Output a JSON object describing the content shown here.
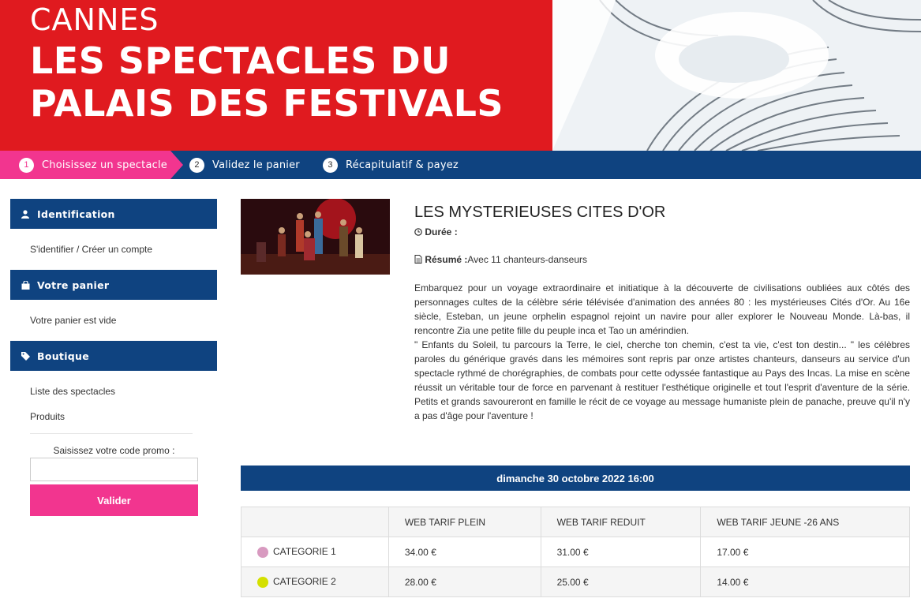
{
  "banner": {
    "city": "CANNES",
    "title_line1": "LES SPECTACLES DU",
    "title_line2": "PALAIS DES FESTIVALS"
  },
  "steps": [
    {
      "num": "1",
      "label": "Choisissez un spectacle"
    },
    {
      "num": "2",
      "label": "Validez le panier"
    },
    {
      "num": "3",
      "label": "Récapitulatif & payez"
    }
  ],
  "sidebar": {
    "identification": {
      "title": "Identification",
      "icon": "user-icon",
      "link": "S'identifier / Créer un compte"
    },
    "panier": {
      "title": "Votre panier",
      "icon": "shopping-bag-icon",
      "text": "Votre panier est vide"
    },
    "boutique": {
      "title": "Boutique",
      "icon": "tag-icon",
      "links": [
        "Liste des spectacles",
        "Produits"
      ]
    },
    "promo": {
      "label": "Saisissez votre code promo :",
      "placeholder": "",
      "button": "Valider"
    }
  },
  "show": {
    "title": "LES MYSTERIEUSES CITES D'OR",
    "duree_label": "Durée :",
    "duree_value": "",
    "resume_label": "Résumé :",
    "resume_value": "Avec 11 chanteurs-danseurs",
    "desc_p1": "Embarquez pour un voyage extraordinaire et initiatique à la découverte de civilisations oubliées aux côtés des personnages cultes de la célèbre série télévisée d'animation des années 80 : les mystérieuses Cités d'Or. Au 16e siècle, Esteban, un jeune orphelin espagnol rejoint un navire pour aller explorer le Nouveau Monde. Là-bas, il rencontre Zia une petite fille du peuple inca et Tao un amérindien.",
    "desc_p2": "\" Enfants du Soleil, tu parcours la Terre, le ciel, cherche ton chemin, c'est ta vie, c'est ton destin... \" les célèbres paroles du générique gravés dans les mémoires sont repris par onze artistes chanteurs, danseurs au service d'un spectacle rythmé de chorégraphies, de combats pour cette odyssée fantastique au Pays des Incas. La mise en scène réussit un véritable tour de force en parvenant à restituer l'esthétique originelle et tout l'esprit d'aventure de la série. Petits et grands savoureront en famille le récit de ce voyage au message humaniste plein de panache, preuve qu'il n'y a pas d'âge pour l'aventure !"
  },
  "session": {
    "date": "dimanche 30 octobre 2022 16:00",
    "headers": [
      "",
      "WEB TARIF PLEIN",
      "WEB TARIF REDUIT",
      "WEB TARIF JEUNE -26 ANS"
    ],
    "rows": [
      {
        "category": "CATEGORIE 1",
        "color": "#d89ac0",
        "prices": [
          "34.00 €",
          "31.00 €",
          "17.00 €"
        ]
      },
      {
        "category": "CATEGORIE 2",
        "color": "#d4e000",
        "prices": [
          "28.00 €",
          "25.00 €",
          "14.00 €"
        ]
      }
    ]
  },
  "colors": {
    "brand_red": "#e01a1f",
    "navy": "#0f4380",
    "pink": "#f2358f"
  }
}
